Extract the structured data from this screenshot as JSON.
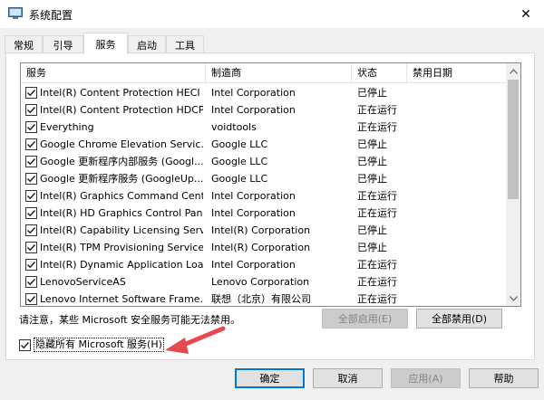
{
  "window": {
    "title": "系统配置",
    "close_glyph": "✕"
  },
  "tabs": [
    {
      "label": "常规"
    },
    {
      "label": "引导"
    },
    {
      "label": "服务",
      "active": true
    },
    {
      "label": "启动"
    },
    {
      "label": "工具"
    }
  ],
  "columns": {
    "name": "服务",
    "maker": "制造商",
    "status": "状态",
    "disabled_date": "禁用日期"
  },
  "services": [
    {
      "name": "Intel(R) Content Protection HECI ...",
      "maker": "Intel Corporation",
      "status": "已停止",
      "checked": true
    },
    {
      "name": "Intel(R) Content Protection HDCP...",
      "maker": "Intel Corporation",
      "status": "正在运行",
      "checked": true
    },
    {
      "name": "Everything",
      "maker": "voidtools",
      "status": "正在运行",
      "checked": true
    },
    {
      "name": "Google Chrome Elevation Servic...",
      "maker": "Google LLC",
      "status": "已停止",
      "checked": true
    },
    {
      "name": "Google 更新程序内部服务 (Googl...",
      "maker": "Google LLC",
      "status": "已停止",
      "checked": true
    },
    {
      "name": "Google 更新程序服务 (GoogleUp...",
      "maker": "Google LLC",
      "status": "已停止",
      "checked": true
    },
    {
      "name": "Intel(R) Graphics Command Cent...",
      "maker": "Intel Corporation",
      "status": "正在运行",
      "checked": true
    },
    {
      "name": "Intel(R) HD Graphics Control Pan...",
      "maker": "Intel Corporation",
      "status": "正在运行",
      "checked": true
    },
    {
      "name": "Intel(R) Capability Licensing Servi...",
      "maker": "Intel(R) Corporation",
      "status": "已停止",
      "checked": true
    },
    {
      "name": "Intel(R) TPM Provisioning Service",
      "maker": "Intel(R) Corporation",
      "status": "已停止",
      "checked": true
    },
    {
      "name": "Intel(R) Dynamic Application Loa...",
      "maker": "Intel Corporation",
      "status": "正在运行",
      "checked": true
    },
    {
      "name": "LenovoServiceAS",
      "maker": "Lenovo Corporation",
      "status": "正在运行",
      "checked": true
    },
    {
      "name": "Lenovo Internet Software Frame...",
      "maker": "联想（北京）有限公司",
      "status": "正在运行",
      "checked": true
    }
  ],
  "note": "请注意，某些 Microsoft 安全服务可能无法禁用。",
  "buttons": {
    "enable_all": "全部启用(E)",
    "disable_all": "全部禁用(D)",
    "ok": "确定",
    "cancel": "取消",
    "apply": "应用(A)",
    "help": "帮助"
  },
  "hide_ms": {
    "label": "隐藏所有 Microsoft 服务(H)",
    "checked": true
  },
  "colors": {
    "accent": "#0078d7",
    "annotation_arrow": "#e8474c",
    "checkmark": "#1a1a1a"
  }
}
